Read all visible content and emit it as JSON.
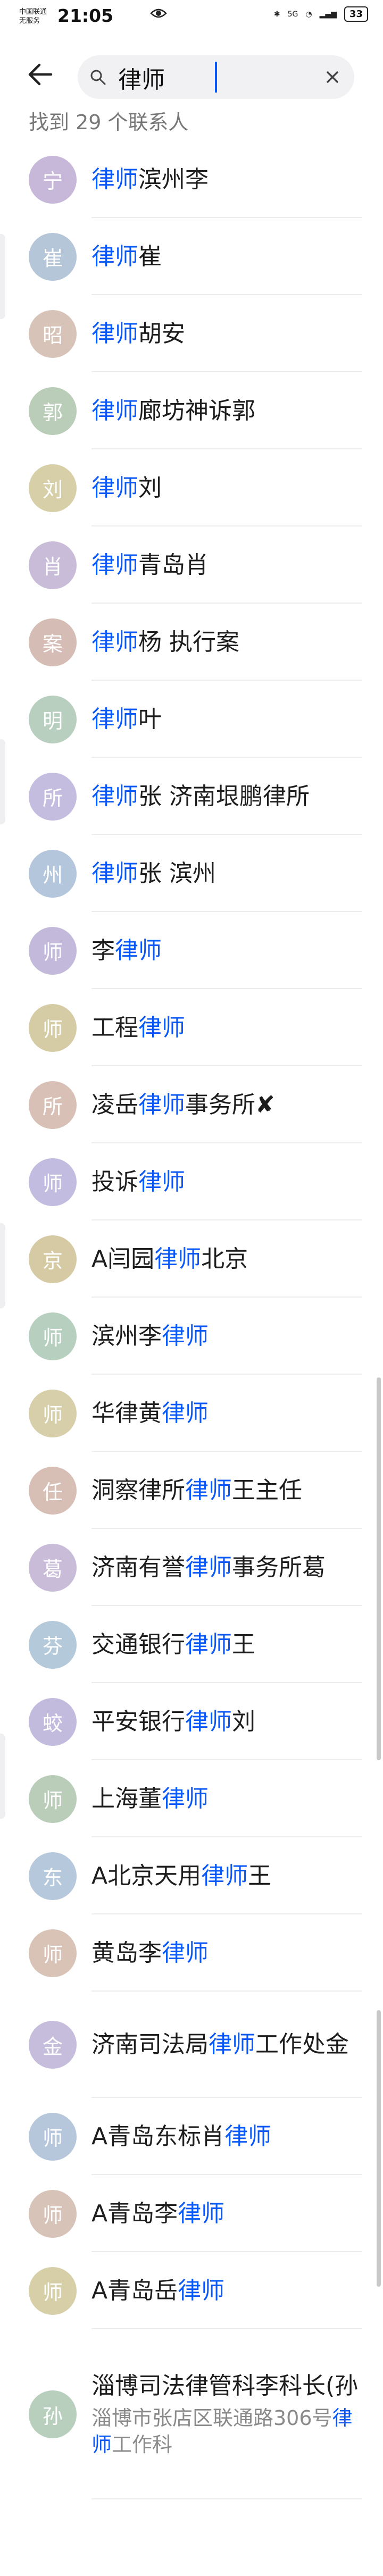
{
  "status_bar": {
    "carrier_line1": "中国联通",
    "carrier_line2": "无服务",
    "time": "21:05",
    "network": "5G",
    "battery": "33"
  },
  "search": {
    "query": "律师",
    "icons": {
      "back": "back-arrow-icon",
      "search": "search-icon",
      "clear": "close-icon"
    }
  },
  "results_count_label": "找到 29 个联系人",
  "contacts": [
    {
      "avatar": "宁",
      "color": "#c7b7d8",
      "pre": "",
      "hl": "律师",
      "post": "滨州李"
    },
    {
      "avatar": "崔",
      "color": "#b5c6d8",
      "pre": "",
      "hl": "律师",
      "post": "崔"
    },
    {
      "avatar": "昭",
      "color": "#d8c3b8",
      "pre": "",
      "hl": "律师",
      "post": "胡安"
    },
    {
      "avatar": "郭",
      "color": "#b9cdb8",
      "pre": "",
      "hl": "律师",
      "post": "廊坊神诉郭"
    },
    {
      "avatar": "刘",
      "color": "#d6cfa8",
      "pre": "",
      "hl": "律师",
      "post": "刘"
    },
    {
      "avatar": "肖",
      "color": "#c9bcd9",
      "pre": "",
      "hl": "律师",
      "post": "青岛肖"
    },
    {
      "avatar": "案",
      "color": "#d5bcb4",
      "pre": "",
      "hl": "律师",
      "post": "杨 执行案"
    },
    {
      "avatar": "明",
      "color": "#b8cfc0",
      "pre": "",
      "hl": "律师",
      "post": "叶"
    },
    {
      "avatar": "所",
      "color": "#c5bde0",
      "pre": "",
      "hl": "律师",
      "post": "张 济南垠鹏律所"
    },
    {
      "avatar": "州",
      "color": "#b4c6dc",
      "pre": "",
      "hl": "律师",
      "post": "张 滨州"
    },
    {
      "avatar": "师",
      "color": "#c3badb",
      "pre": "李",
      "hl": "律师",
      "post": ""
    },
    {
      "avatar": "师",
      "color": "#d5cca6",
      "pre": "工程",
      "hl": "律师",
      "post": ""
    },
    {
      "avatar": "所",
      "color": "#d8c0b6",
      "pre": "凌岳",
      "hl": "律师",
      "post": "事务所✘"
    },
    {
      "avatar": "师",
      "color": "#c2bce0",
      "pre": "投诉",
      "hl": "律师",
      "post": ""
    },
    {
      "avatar": "京",
      "color": "#d6caa4",
      "pre": "A闫园",
      "hl": "律师",
      "post": "北京"
    },
    {
      "avatar": "师",
      "color": "#b7cfbf",
      "pre": "滨州李",
      "hl": "律师",
      "post": ""
    },
    {
      "avatar": "师",
      "color": "#d6cfa9",
      "pre": "华律黄",
      "hl": "律师",
      "post": ""
    },
    {
      "avatar": "任",
      "color": "#d8bfb6",
      "pre": "洞察律所",
      "hl": "律师",
      "post": "王主任"
    },
    {
      "avatar": "葛",
      "color": "#c9bcd9",
      "pre": "济南有誉",
      "hl": "律师",
      "post": "事务所葛"
    },
    {
      "avatar": "芬",
      "color": "#b4c9da",
      "pre": "交通银行",
      "hl": "律师",
      "post": "王"
    },
    {
      "avatar": "蛟",
      "color": "#c3bbde",
      "pre": "平安银行",
      "hl": "律师",
      "post": "刘"
    },
    {
      "avatar": "师",
      "color": "#b9cdb9",
      "pre": "上海董",
      "hl": "律师",
      "post": ""
    },
    {
      "avatar": "东",
      "color": "#b6c8dc",
      "pre": "A北京天用",
      "hl": "律师",
      "post": "王"
    },
    {
      "avatar": "师",
      "color": "#d8c3b6",
      "pre": "黄岛李",
      "hl": "律师",
      "post": ""
    },
    {
      "avatar": "金",
      "color": "#c6bddc",
      "pre": "济南司法局",
      "hl": "律师",
      "post": "工作处金",
      "tall": true
    },
    {
      "avatar": "师",
      "color": "#b6c7db",
      "pre": "A青岛东标肖",
      "hl": "律师",
      "post": ""
    },
    {
      "avatar": "师",
      "color": "#d7c3b7",
      "pre": "A青岛李",
      "hl": "律师",
      "post": ""
    },
    {
      "avatar": "师",
      "color": "#d6cfa8",
      "pre": "A青岛岳",
      "hl": "律师",
      "post": ""
    },
    {
      "avatar": "孙",
      "color": "#b8cfbd",
      "pre": "淄博司法律管科李科长(孙",
      "hl": "",
      "post": "",
      "sub_pre": "淄博市张店区联通路306号",
      "sub_hl": "律师",
      "sub_post": "工作科",
      "xtall": true
    }
  ]
}
